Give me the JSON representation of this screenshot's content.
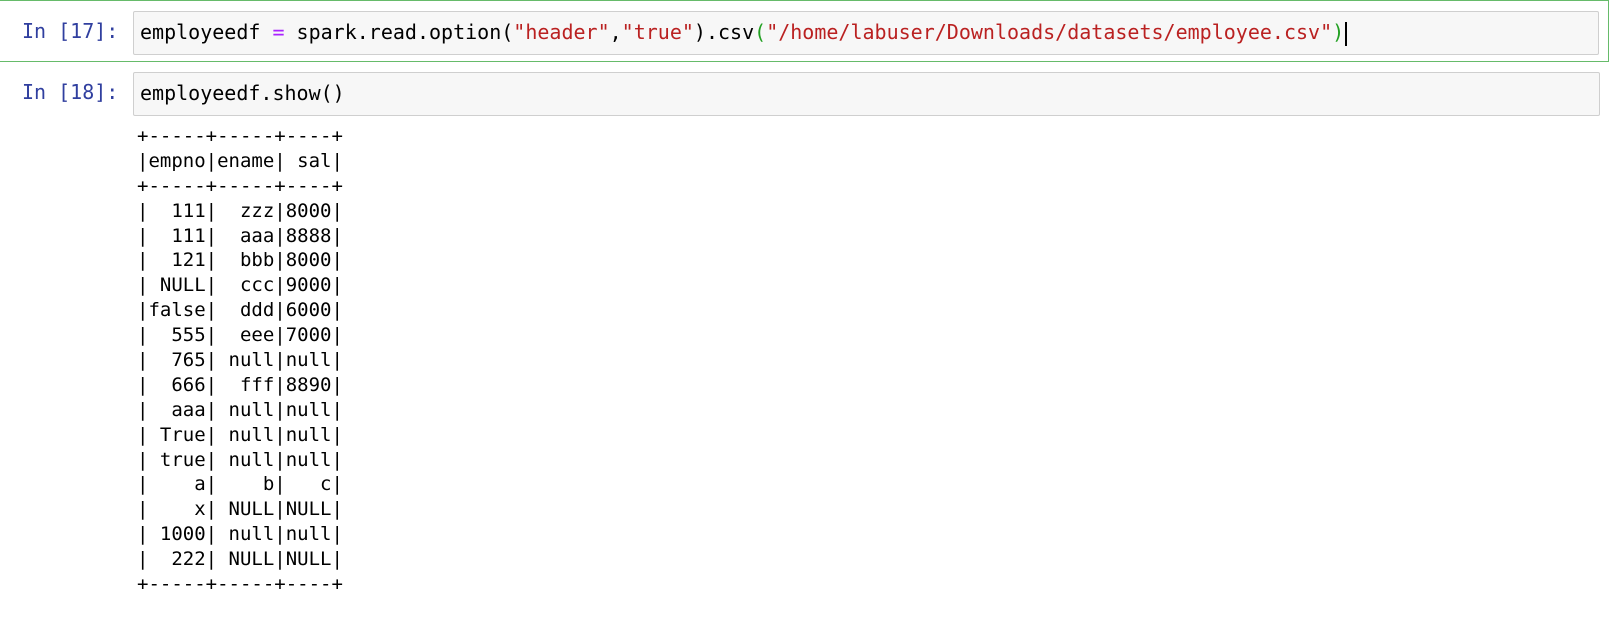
{
  "cells": [
    {
      "prompt": "In [17]:",
      "code": {
        "var": "employeedf",
        "op": " = ",
        "call_prefix": "spark.read.option(",
        "arg1": "\"header\"",
        "comma": ",",
        "arg2": "\"true\"",
        "call_mid": ").csv",
        "paren_open": "(",
        "path": "\"/home/labuser/Downloads/datasets/employee.csv\"",
        "paren_close": ")"
      }
    },
    {
      "prompt": "In [18]:",
      "code_text": "employeedf.show()"
    }
  ],
  "output": {
    "border": "+-----+-----+----+",
    "header": "|empno|ename| sal|",
    "rows": [
      "|  111|  zzz|8000|",
      "|  111|  aaa|8888|",
      "|  121|  bbb|8000|",
      "| NULL|  ccc|9000|",
      "|false|  ddd|6000|",
      "|  555|  eee|7000|",
      "|  765| null|null|",
      "|  666|  fff|8890|",
      "|  aaa| null|null|",
      "| True| null|null|",
      "| true| null|null|",
      "|    a|    b|   c|",
      "|    x| NULL|NULL|",
      "| 1000| null|null|",
      "|  222| NULL|NULL|"
    ]
  },
  "colors": {
    "prompt": "#303f9f",
    "string": "#ba2121",
    "operator": "#aa22ff",
    "matched_paren": "#22a022",
    "selected_cell_border": "#66bb6a"
  }
}
